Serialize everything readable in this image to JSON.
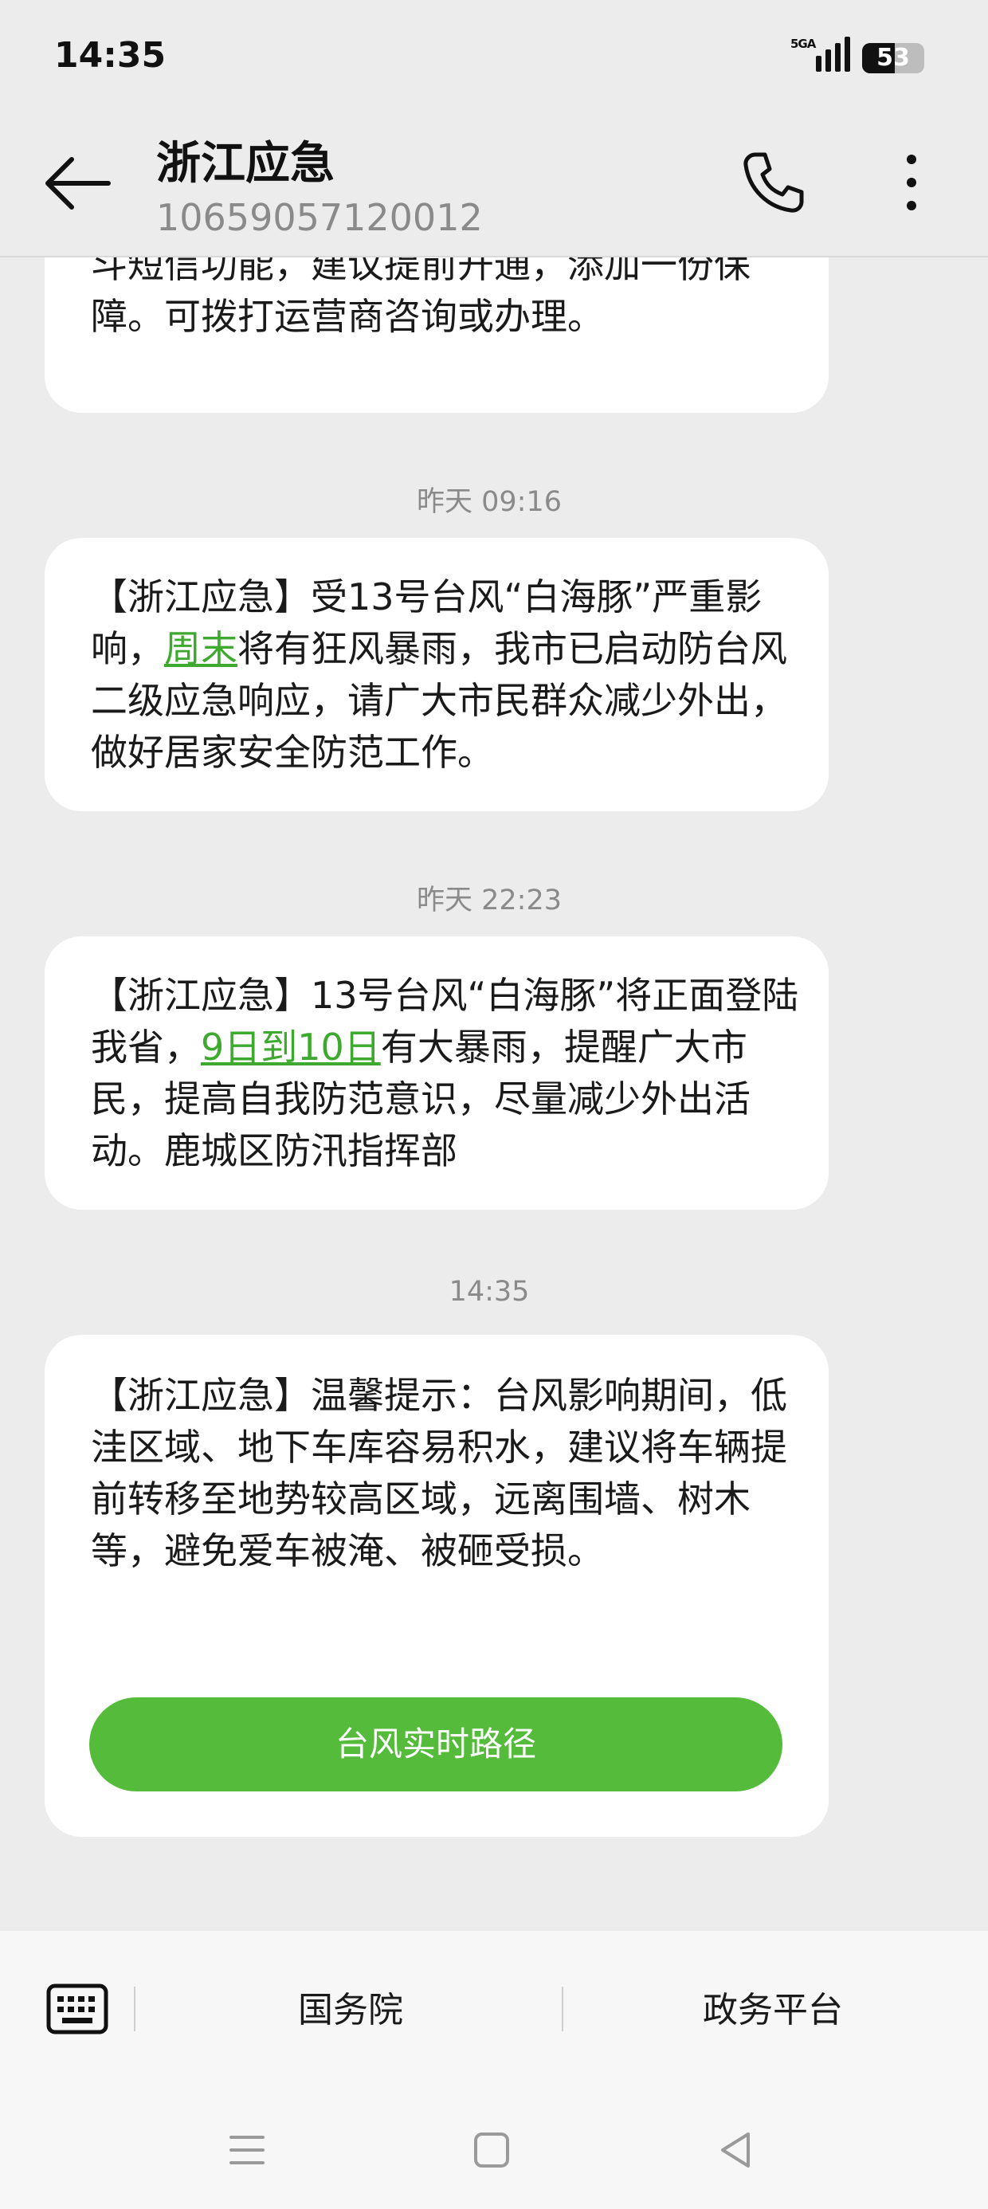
{
  "status_bar": {
    "time": "14:35",
    "network": "5GA",
    "battery": 53
  },
  "header": {
    "title": "浙江应急",
    "number": "10659057120012",
    "icons": {
      "back": "arrow-left-icon",
      "call": "phone-icon",
      "more": "more-vertical-icon"
    }
  },
  "messages": [
    {
      "segments": [
        {
          "text": "省，易造成通信中断。芯手机如具备发送北斗短信功能，建议提前开通，添加一份保障。可拨打运营商咨询或办理。",
          "link": false
        }
      ]
    },
    {
      "time": "昨天 09:16",
      "segments": [
        {
          "text": "【浙江应急】受13号台风“白海豚”严重影响，",
          "link": false
        },
        {
          "text": "周末",
          "link": true
        },
        {
          "text": "将有狂风暴雨，我市已启动防台风二级应急响应，请广大市民群众减少外出，做好居家安全防范工作。",
          "link": false
        }
      ]
    },
    {
      "time": "昨天 22:23",
      "segments": [
        {
          "text": "【浙江应急】13号台风“白海豚”将正面登陆我省，",
          "link": false
        },
        {
          "text": "9日到10日",
          "link": true
        },
        {
          "text": "有大暴雨，提醒广大市民，提高自我防范意识，尽量减少外出活动。鹿城区防汛指挥部",
          "link": false
        }
      ]
    },
    {
      "time": "14:35",
      "segments": [
        {
          "text": "【浙江应急】温馨提示：台风影响期间，低洼区域、地下车库容易积水，建议将车辆提前转移至地势较高区域，远离围墙、树木等，避免爱车被淹、被砸受损。",
          "link": false
        }
      ],
      "button": "台风实时路径"
    }
  ],
  "bottom_bar": {
    "keyboard_icon": "keyboard-icon",
    "items": [
      "国务院",
      "政务平台"
    ]
  },
  "nav_bar": {
    "icons": [
      "menu-icon",
      "home-square-icon",
      "back-triangle-icon"
    ]
  },
  "colors": {
    "accent": "#55bb3a",
    "link": "#3da92e",
    "background": "#ececec",
    "bubble": "#ffffff"
  }
}
